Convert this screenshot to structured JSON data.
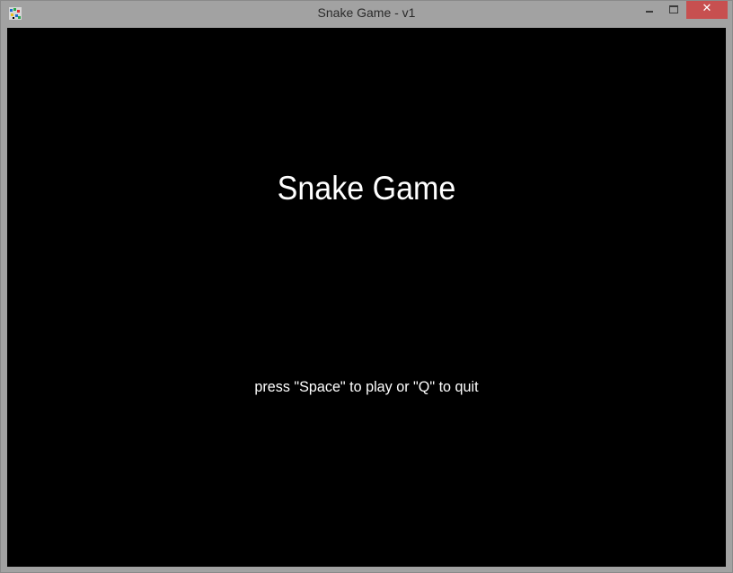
{
  "window": {
    "title": "Snake Game - v1",
    "app_icon": "snake-app-icon",
    "controls": {
      "minimize_icon": "minimize-icon",
      "maximize_icon": "maximize-icon",
      "close_icon": "close-icon",
      "close_glyph": "✕"
    },
    "close_color": "#c75050",
    "titlebar_color": "#a2a2a2"
  },
  "game": {
    "background": "#000000",
    "text_color": "#ffffff",
    "title": "Snake Game",
    "prompt": "press \"Space\" to play or \"Q\" to quit"
  }
}
